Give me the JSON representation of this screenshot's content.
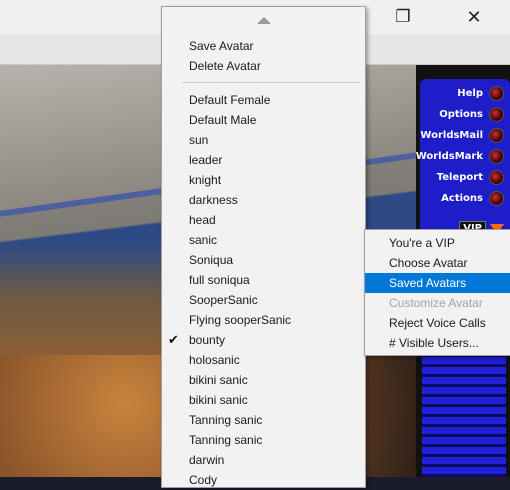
{
  "window": {
    "restore_glyph": "❐",
    "close_glyph": "✕"
  },
  "side_panel": {
    "buttons": [
      {
        "label": "Help"
      },
      {
        "label": "Options"
      },
      {
        "label": "WorldsMail"
      },
      {
        "label": "WorldsMark"
      },
      {
        "label": "Teleport"
      },
      {
        "label": "Actions"
      }
    ],
    "vip_label": "VIP"
  },
  "main_menu": {
    "scroll_up_icon": "triangle-up",
    "actions": [
      "Save Avatar",
      "Delete Avatar"
    ],
    "avatars": [
      "Default Female",
      "Default Male",
      "sun",
      "leader",
      "knight",
      "darkness",
      "head",
      "sanic",
      "Soniqua",
      "full soniqua",
      "SooperSanic",
      "Flying sooperSanic",
      "bounty",
      "holosanic",
      "bikini sanic",
      "bikini sanic",
      "Tanning sanic",
      "Tanning sanic",
      "darwin",
      "Cody"
    ],
    "checked_index": 12,
    "check_glyph": "✔"
  },
  "sub_menu": {
    "items": [
      {
        "label": "You're a VIP",
        "state": "normal"
      },
      {
        "label": "Choose Avatar",
        "state": "normal"
      },
      {
        "label": "Saved Avatars",
        "state": "highlighted"
      },
      {
        "label": "Customize Avatar",
        "state": "disabled"
      },
      {
        "label": "Reject Voice Calls",
        "state": "normal"
      },
      {
        "label": "# Visible Users...",
        "state": "normal"
      }
    ],
    "highlight_color": "#0078d7"
  }
}
